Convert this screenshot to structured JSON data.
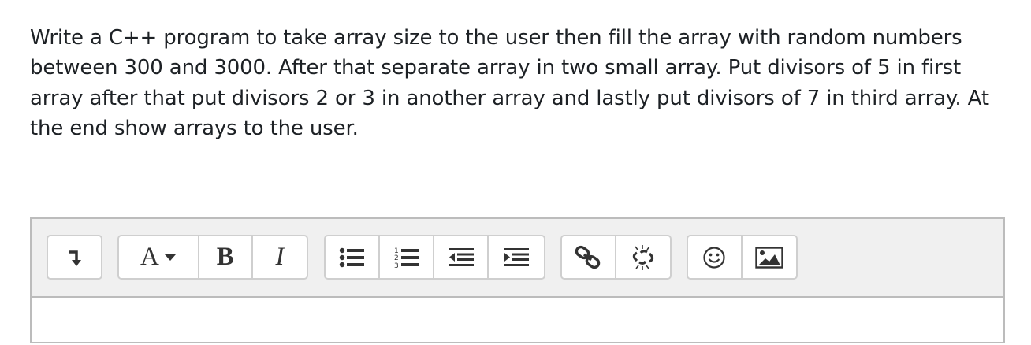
{
  "question": {
    "text": "Write a C++ program to take array size to the user then fill the array with random numbers between 300 and 3000. After that separate array in two small array. Put divisors of 5 in first array after that put divisors 2 or 3 in another array and lastly put divisors of 7 in third array. At the end show arrays to the user."
  },
  "toolbar": {
    "font_label": "A",
    "bold_label": "B",
    "italic_label": "I"
  },
  "icons": [
    "toggle-toolbar-icon",
    "font-style-icon",
    "caret-down-icon",
    "bold-icon",
    "italic-icon",
    "unordered-list-icon",
    "ordered-list-icon",
    "outdent-icon",
    "indent-icon",
    "link-icon",
    "unlink-icon",
    "emoticon-icon",
    "image-icon"
  ],
  "colors": {
    "toolbar_bg": "#f0f0f0",
    "border": "#bcbcbc",
    "icon": "#333333"
  }
}
